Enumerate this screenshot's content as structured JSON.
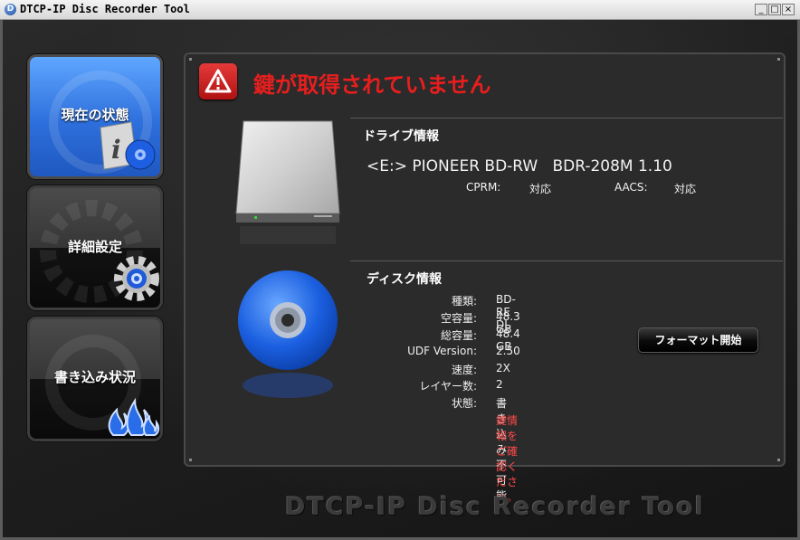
{
  "window": {
    "title": "DTCP-IP Disc Recorder Tool",
    "minimize": "_",
    "maximize": "□",
    "close": "×"
  },
  "sidebar": {
    "items": [
      {
        "label": "現在の状態",
        "selected": true
      },
      {
        "label": "詳細設定",
        "selected": false
      },
      {
        "label": "書き込み状況",
        "selected": false
      }
    ]
  },
  "status": {
    "warning_title": "鍵が取得されていません",
    "warning_icon": "warning-triangle-icon"
  },
  "drive": {
    "section_title": "ドライブ情報",
    "name": "<E:> PIONEER BD-RW   BDR-208M 1.10",
    "cprm_label": "CPRM:",
    "cprm_value": "対応",
    "aacs_label": "AACS:",
    "aacs_value": "対応"
  },
  "disc": {
    "section_title": "ディスク情報",
    "rows": [
      {
        "label": "種類:",
        "value": "BD-RE DL"
      },
      {
        "label": "空容量:",
        "value": "48.3 GB"
      },
      {
        "label": "総容量:",
        "value": "48.4 GB"
      },
      {
        "label": "UDF Version:",
        "value": "2.50"
      },
      {
        "label": "速度:",
        "value": "2X"
      },
      {
        "label": "レイヤー数:",
        "value": "2"
      },
      {
        "label": "状態:",
        "value": "書き込み不可能"
      }
    ],
    "alert": "鍵情報をご確認ください。",
    "format_button": "フォーマット開始"
  },
  "footer": {
    "logo": "DTCP-IP Disc Recorder Tool"
  },
  "colors": {
    "accent_blue": "#2d6fdc",
    "warning_red": "#e81e1e",
    "alert_red": "#ff4a4a"
  }
}
